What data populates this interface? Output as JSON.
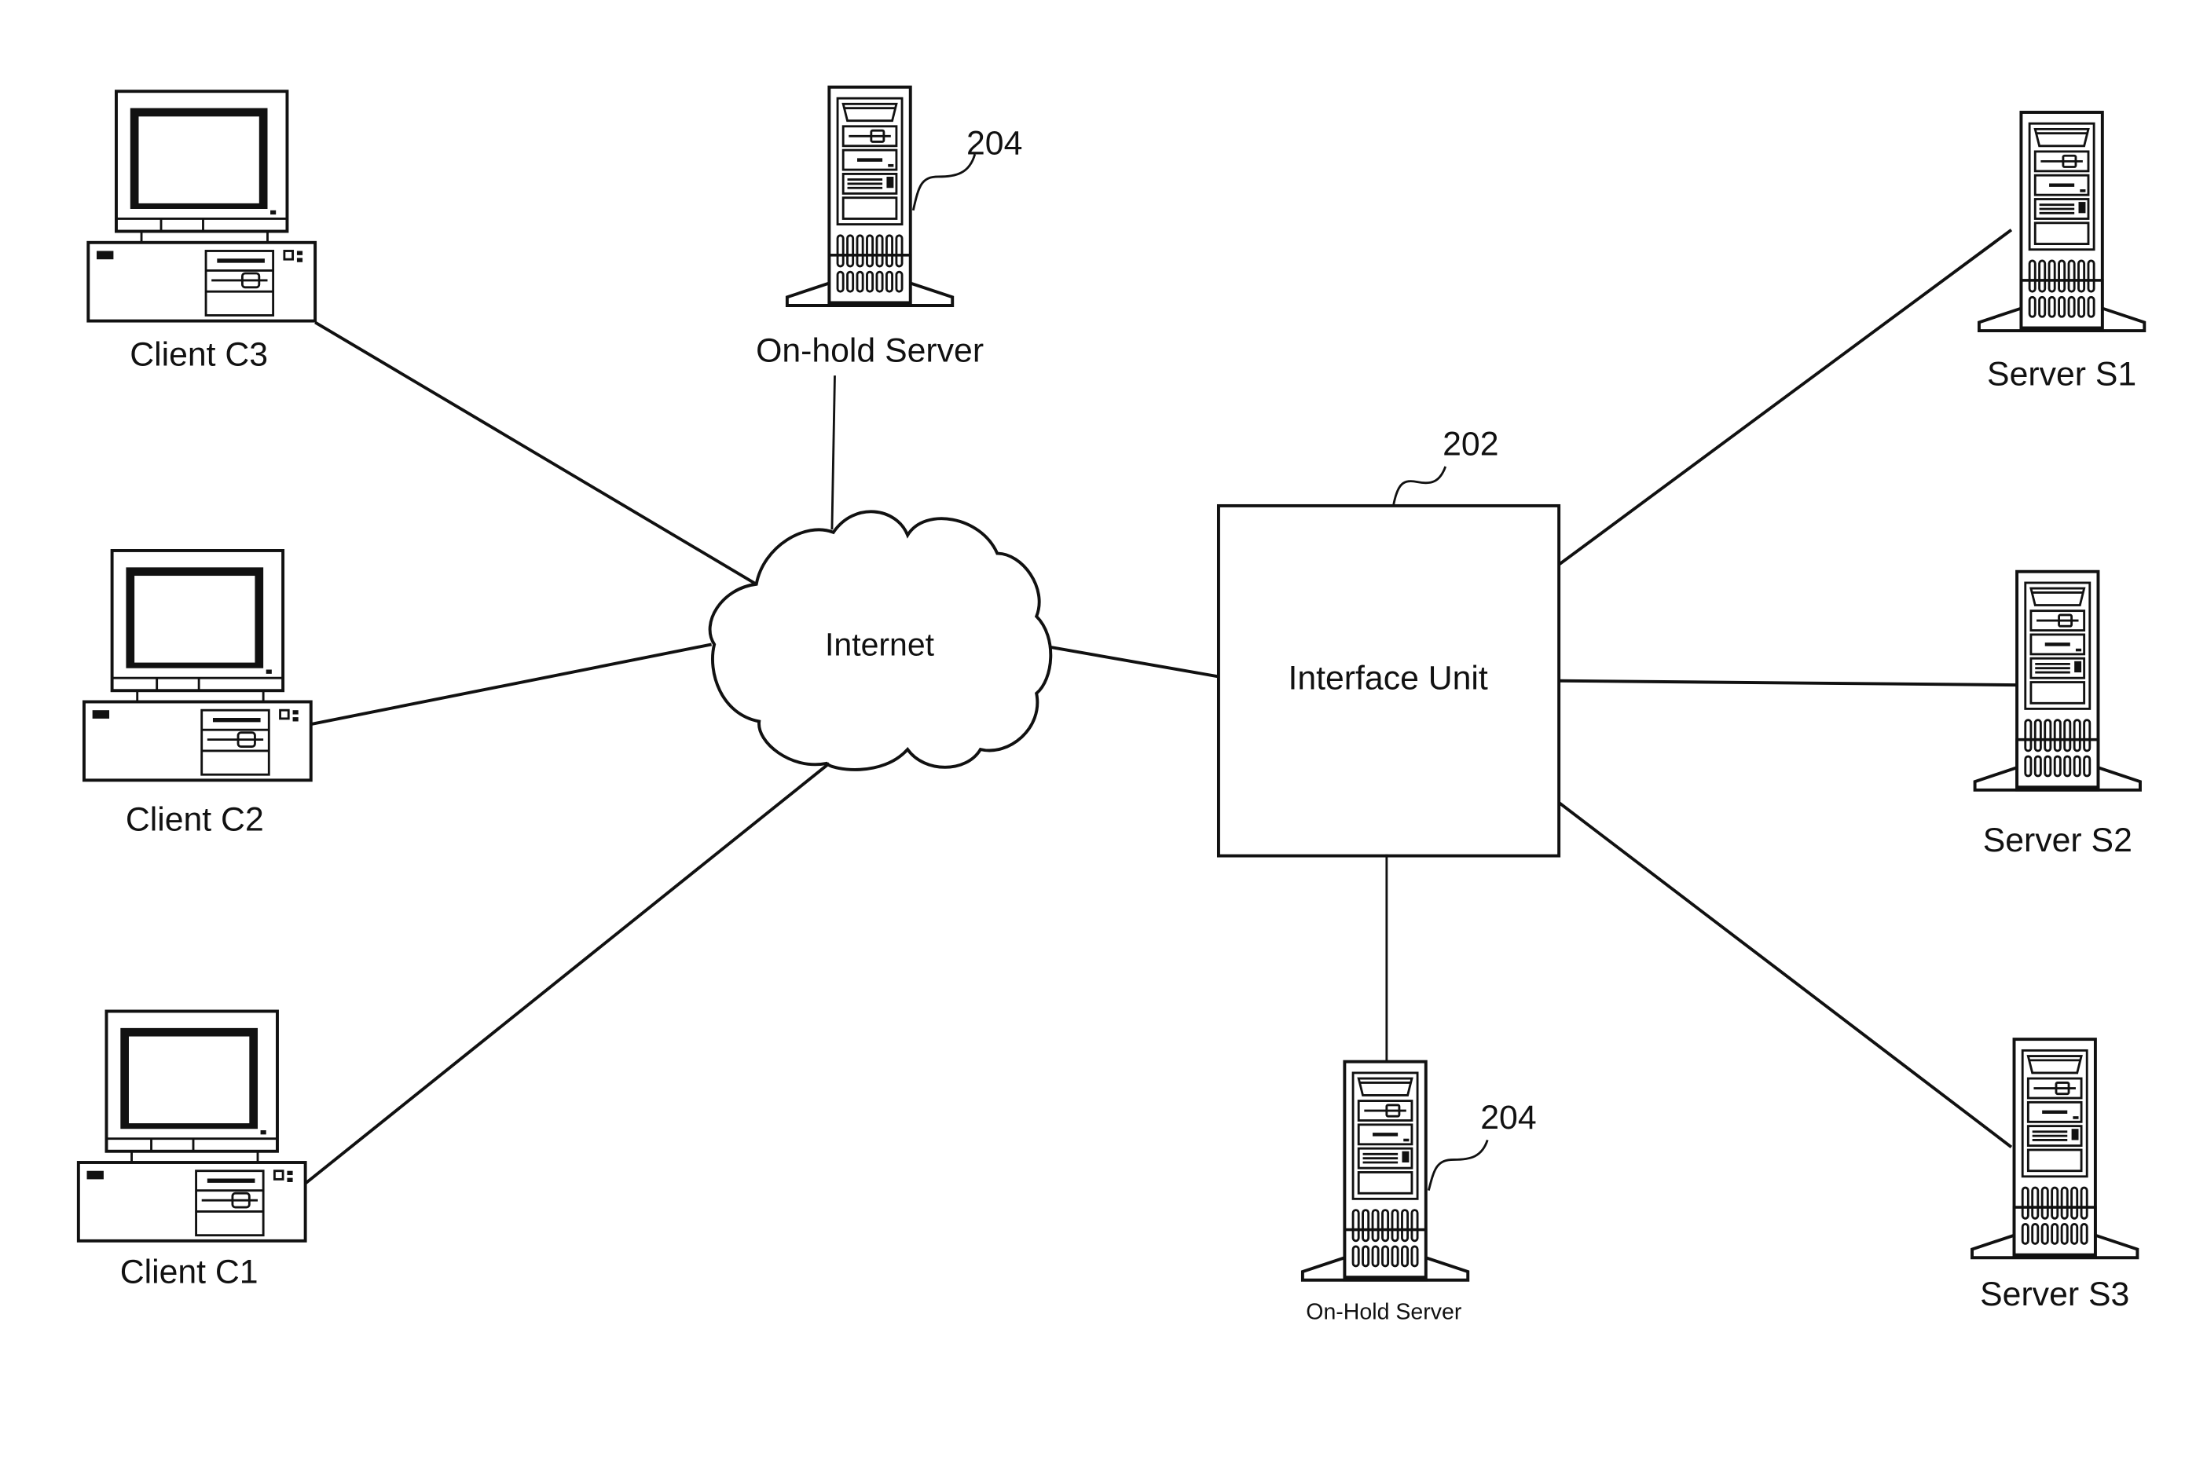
{
  "diagram": {
    "internet": {
      "label": "Internet"
    },
    "interface_unit": {
      "label": "Interface Unit",
      "ref": "202"
    },
    "clients": [
      {
        "label": "Client C3"
      },
      {
        "label": "Client C2"
      },
      {
        "label": "Client C1"
      }
    ],
    "servers": [
      {
        "label": "Server S1"
      },
      {
        "label": "Server S2"
      },
      {
        "label": "Server S3"
      }
    ],
    "onhold_top": {
      "label": "On-hold Server",
      "ref": "204"
    },
    "onhold_bottom": {
      "label": "On-Hold Server",
      "ref": "204"
    }
  }
}
